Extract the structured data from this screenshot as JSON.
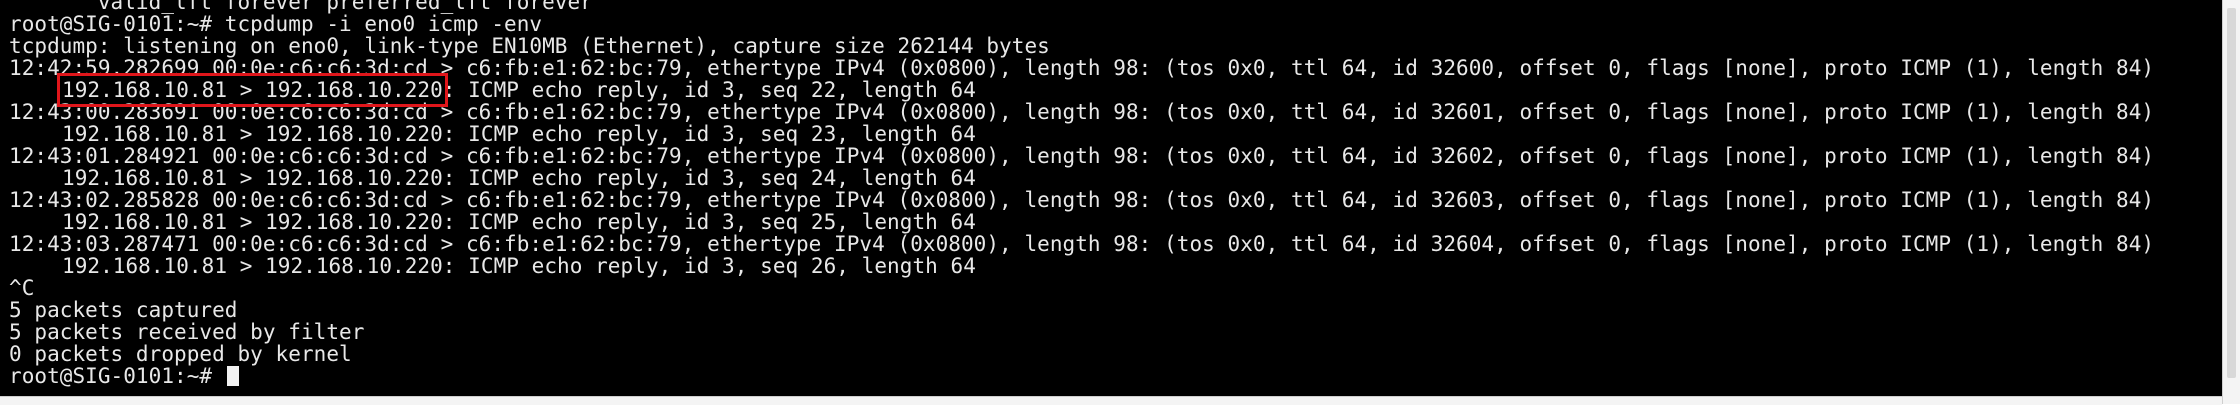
{
  "terminal": {
    "lines": [
      {
        "text": "       valid_lft forever preferred_lft forever"
      },
      {
        "text": "root@SIG-0101:~# tcpdump -i eno0 icmp -env"
      },
      {
        "text": "tcpdump: listening on eno0, link-type EN10MB (Ethernet), capture size 262144 bytes"
      },
      {
        "text": "12:42:59.282699 00:0e:c6:c6:3d:cd > c6:fb:e1:62:bc:79, ethertype IPv4 (0x0800), length 98: (tos 0x0, ttl 64, id 32600, offset 0, flags [none], proto ICMP (1), length 84)"
      },
      {
        "addr": "192.168.10.81 > 192.168.10.220",
        "rest": ": ICMP echo reply, id 3, seq 22, length 64"
      },
      {
        "text": "12:43:00.283691 00:0e:c6:c6:3d:cd > c6:fb:e1:62:bc:79, ethertype IPv4 (0x0800), length 98: (tos 0x0, ttl 64, id 32601, offset 0, flags [none], proto ICMP (1), length 84)"
      },
      {
        "addr": "192.168.10.81 > 192.168.10.220",
        "rest": ": ICMP echo reply, id 3, seq 23, length 64"
      },
      {
        "text": "12:43:01.284921 00:0e:c6:c6:3d:cd > c6:fb:e1:62:bc:79, ethertype IPv4 (0x0800), length 98: (tos 0x0, ttl 64, id 32602, offset 0, flags [none], proto ICMP (1), length 84)"
      },
      {
        "addr": "192.168.10.81 > 192.168.10.220",
        "rest": ": ICMP echo reply, id 3, seq 24, length 64"
      },
      {
        "text": "12:43:02.285828 00:0e:c6:c6:3d:cd > c6:fb:e1:62:bc:79, ethertype IPv4 (0x0800), length 98: (tos 0x0, ttl 64, id 32603, offset 0, flags [none], proto ICMP (1), length 84)"
      },
      {
        "addr": "192.168.10.81 > 192.168.10.220",
        "rest": ": ICMP echo reply, id 3, seq 25, length 64"
      },
      {
        "text": "12:43:03.287471 00:0e:c6:c6:3d:cd > c6:fb:e1:62:bc:79, ethertype IPv4 (0x0800), length 98: (tos 0x0, ttl 64, id 32604, offset 0, flags [none], proto ICMP (1), length 84)"
      },
      {
        "addr": "192.168.10.81 > 192.168.10.220",
        "rest": ": ICMP echo reply, id 3, seq 26, length 64"
      },
      {
        "text": "^C"
      },
      {
        "text": "5 packets captured"
      },
      {
        "text": "5 packets received by filter"
      },
      {
        "text": "0 packets dropped by kernel"
      }
    ],
    "prompt": "root@SIG-0101:~# ",
    "highlight_line_index": 4
  },
  "colors": {
    "background": "#000000",
    "text": "#e8e8e8",
    "highlight": "#e0161b",
    "cursor": "#f2f2f2"
  }
}
